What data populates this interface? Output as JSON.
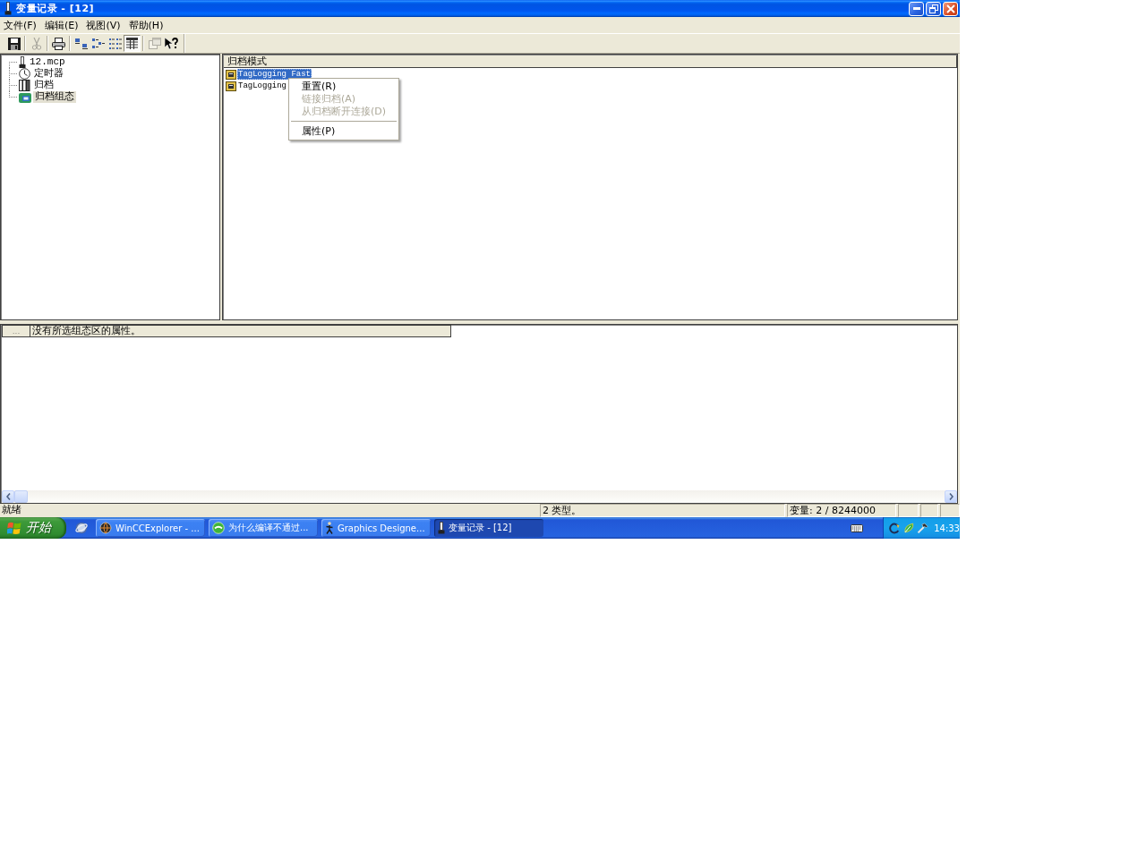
{
  "window": {
    "title": "变量记录 - [12]"
  },
  "menu_bar": [
    {
      "label": "文件(F)"
    },
    {
      "label": "编辑(E)"
    },
    {
      "label": "视图(V)"
    },
    {
      "label": "帮助(H)"
    }
  ],
  "toolbar": {
    "groups": [
      [
        {
          "kind": "save",
          "disabled": false,
          "pressed": false
        }
      ],
      [
        {
          "kind": "cut",
          "disabled": true,
          "pressed": false
        }
      ],
      [
        {
          "kind": "print",
          "disabled": false,
          "pressed": false
        }
      ],
      [
        {
          "kind": "large",
          "disabled": false,
          "pressed": false
        },
        {
          "kind": "small",
          "disabled": false,
          "pressed": false
        },
        {
          "kind": "list",
          "disabled": false,
          "pressed": false
        },
        {
          "kind": "details",
          "disabled": false,
          "pressed": true
        }
      ],
      [
        {
          "kind": "properties",
          "disabled": true,
          "pressed": false
        },
        {
          "kind": "help",
          "disabled": false,
          "pressed": false
        }
      ]
    ]
  },
  "tree": {
    "items": [
      {
        "label": "12.mcp",
        "kind": "project",
        "selected": false
      },
      {
        "label": "定时器",
        "kind": "timer",
        "selected": false
      },
      {
        "label": "归档",
        "kind": "archive",
        "selected": false
      },
      {
        "label": "归档组态",
        "kind": "configuration",
        "selected": true
      }
    ]
  },
  "list": {
    "columns": [
      {
        "label": "归档模式"
      }
    ],
    "items": [
      {
        "label": "TagLogging Fast",
        "selected": true
      },
      {
        "label": "TagLogging",
        "selected": false
      }
    ]
  },
  "context_menu": {
    "groups": [
      [
        {
          "label": "重置(R)",
          "disabled": false
        },
        {
          "label": "链接归档(A)",
          "disabled": true
        },
        {
          "label": "从归档断开连接(D)",
          "disabled": true
        }
      ],
      [
        {
          "label": "属性(P)",
          "disabled": false
        }
      ]
    ]
  },
  "properties_panel": {
    "button": "...",
    "message": "没有所选组态区的属性。"
  },
  "status_bar": {
    "panes": [
      "就绪",
      "2 类型。",
      "变量: 2 / 8244000"
    ]
  },
  "taskbar": {
    "start": "开始",
    "tasks": [
      {
        "label": "WinCCExplorer - ...",
        "kind": "explorer",
        "selected": false
      },
      {
        "label": "为什么编译不通过...",
        "kind": "chat",
        "selected": false
      },
      {
        "label": "Graphics Designe...",
        "kind": "designer",
        "selected": false
      },
      {
        "label": "变量记录 - [12]",
        "kind": "logging",
        "selected": true
      }
    ],
    "clock": "14:33"
  }
}
